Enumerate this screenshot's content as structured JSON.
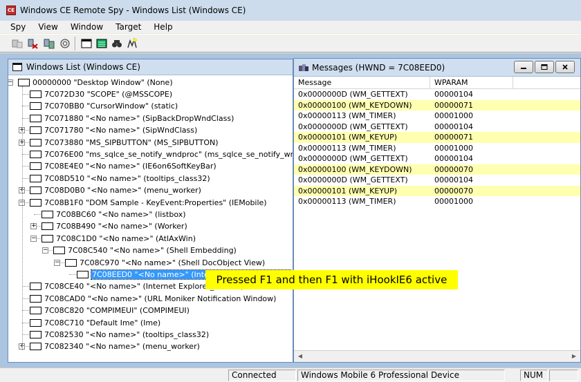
{
  "app": {
    "title": "Windows CE Remote Spy - Windows List (Windows CE)",
    "icon": "app-icon"
  },
  "menu": [
    "Spy",
    "View",
    "Window",
    "Target",
    "Help"
  ],
  "toolbar": {
    "buttons": [
      "connect-icon",
      "disconnect-icon",
      "refresh-icon",
      "settings-icon",
      "window-icon",
      "list-icon",
      "find-icon",
      "target-icon"
    ]
  },
  "tree": {
    "title": "Windows List (Windows CE)",
    "nodes": [
      {
        "text": "00000000 \"Desktop Window\" (None)",
        "depth": 0,
        "expander": "-"
      },
      {
        "text": "7C072D30 \"SCOPE\" (@MSSCOPE)",
        "depth": 1,
        "expander": ""
      },
      {
        "text": "7C070BB0 \"CursorWindow\" (static)",
        "depth": 1,
        "expander": ""
      },
      {
        "text": "7C071880 \"<No name>\" (SipBackDropWndClass)",
        "depth": 1,
        "expander": ""
      },
      {
        "text": "7C071780 \"<No name>\" (SipWndClass)",
        "depth": 1,
        "expander": "+"
      },
      {
        "text": "7C073880 \"MS_SIPBUTTON\" (MS_SIPBUTTON)",
        "depth": 1,
        "expander": "+"
      },
      {
        "text": "7C076E00 \"ms_sqlce_se_notify_wndproc\" (ms_sqlce_se_notify_wndp",
        "depth": 1,
        "expander": ""
      },
      {
        "text": "7C08E4E0 \"<No name>\" (IE6on6SoftKeyBar)",
        "depth": 1,
        "expander": ""
      },
      {
        "text": "7C08D510 \"<No name>\" (tooltips_class32)",
        "depth": 1,
        "expander": ""
      },
      {
        "text": "7C08D0B0 \"<No name>\" (menu_worker)",
        "depth": 1,
        "expander": "+"
      },
      {
        "text": "7C08B1F0 \"DOM Sample - KeyEvent:Properties\" (IEMobile)",
        "depth": 1,
        "expander": "-"
      },
      {
        "text": "7C08BC60 \"<No name>\" (listbox)",
        "depth": 2,
        "expander": ""
      },
      {
        "text": "7C08B490 \"<No name>\" (Worker)",
        "depth": 2,
        "expander": "+"
      },
      {
        "text": "7C08C1D0 \"<No name>\" (AtlAxWin)",
        "depth": 2,
        "expander": "-"
      },
      {
        "text": "7C08C540 \"<No name>\" (Shell Embedding)",
        "depth": 3,
        "expander": "-"
      },
      {
        "text": "7C08C970 \"<No name>\" (Shell DocObject View)",
        "depth": 4,
        "expander": "-"
      },
      {
        "text": "7C08EED0 \"<No name>\" (Internet Explorer_Server)",
        "depth": 5,
        "expander": "",
        "selected": true
      },
      {
        "text": "7C08CE40 \"<No name>\" (Internet Explorer_Hidden)",
        "depth": 1,
        "expander": ""
      },
      {
        "text": "7C08CAD0 \"<No name>\" (URL Moniker Notification Window)",
        "depth": 1,
        "expander": ""
      },
      {
        "text": "7C08C820 \"COMPIMEUI\" (COMPIMEUI)",
        "depth": 1,
        "expander": ""
      },
      {
        "text": "7C08C710 \"Default Ime\" (Ime)",
        "depth": 1,
        "expander": ""
      },
      {
        "text": "7C082530 \"<No name>\" (tooltips_class32)",
        "depth": 1,
        "expander": ""
      },
      {
        "text": "7C082340 \"<No name>\" (menu_worker)",
        "depth": 1,
        "expander": "+"
      }
    ]
  },
  "messages": {
    "title": "Messages (HWND = 7C08EED0)",
    "columns": [
      "Message",
      "WPARAM"
    ],
    "rows": [
      {
        "msg": "0x0000000D (WM_GETTEXT)",
        "wparam": "00000104",
        "highlight": false
      },
      {
        "msg": "0x00000100 (WM_KEYDOWN)",
        "wparam": "00000071",
        "highlight": true
      },
      {
        "msg": "0x00000113 (WM_TIMER)",
        "wparam": "00001000",
        "highlight": false
      },
      {
        "msg": "0x0000000D (WM_GETTEXT)",
        "wparam": "00000104",
        "highlight": false
      },
      {
        "msg": "0x00000101 (WM_KEYUP)",
        "wparam": "00000071",
        "highlight": true
      },
      {
        "msg": "0x00000113 (WM_TIMER)",
        "wparam": "00001000",
        "highlight": false
      },
      {
        "msg": "0x0000000D (WM_GETTEXT)",
        "wparam": "00000104",
        "highlight": false
      },
      {
        "msg": "0x00000100 (WM_KEYDOWN)",
        "wparam": "00000070",
        "highlight": true
      },
      {
        "msg": "0x0000000D (WM_GETTEXT)",
        "wparam": "00000104",
        "highlight": false
      },
      {
        "msg": "0x00000101 (WM_KEYUP)",
        "wparam": "00000070",
        "highlight": true
      },
      {
        "msg": "0x00000113 (WM_TIMER)",
        "wparam": "00001000",
        "highlight": false
      }
    ]
  },
  "callout": "Pressed F1 and then F1 with iHookIE6 active",
  "status": {
    "connection": "Connected",
    "device": "Windows Mobile 6 Professional Device",
    "num": "NUM"
  },
  "colors": {
    "highlight_row": "#ffffb0",
    "callout_bg": "#ffff00",
    "selection": "#3399ff",
    "workspace": "#abc5e0"
  }
}
